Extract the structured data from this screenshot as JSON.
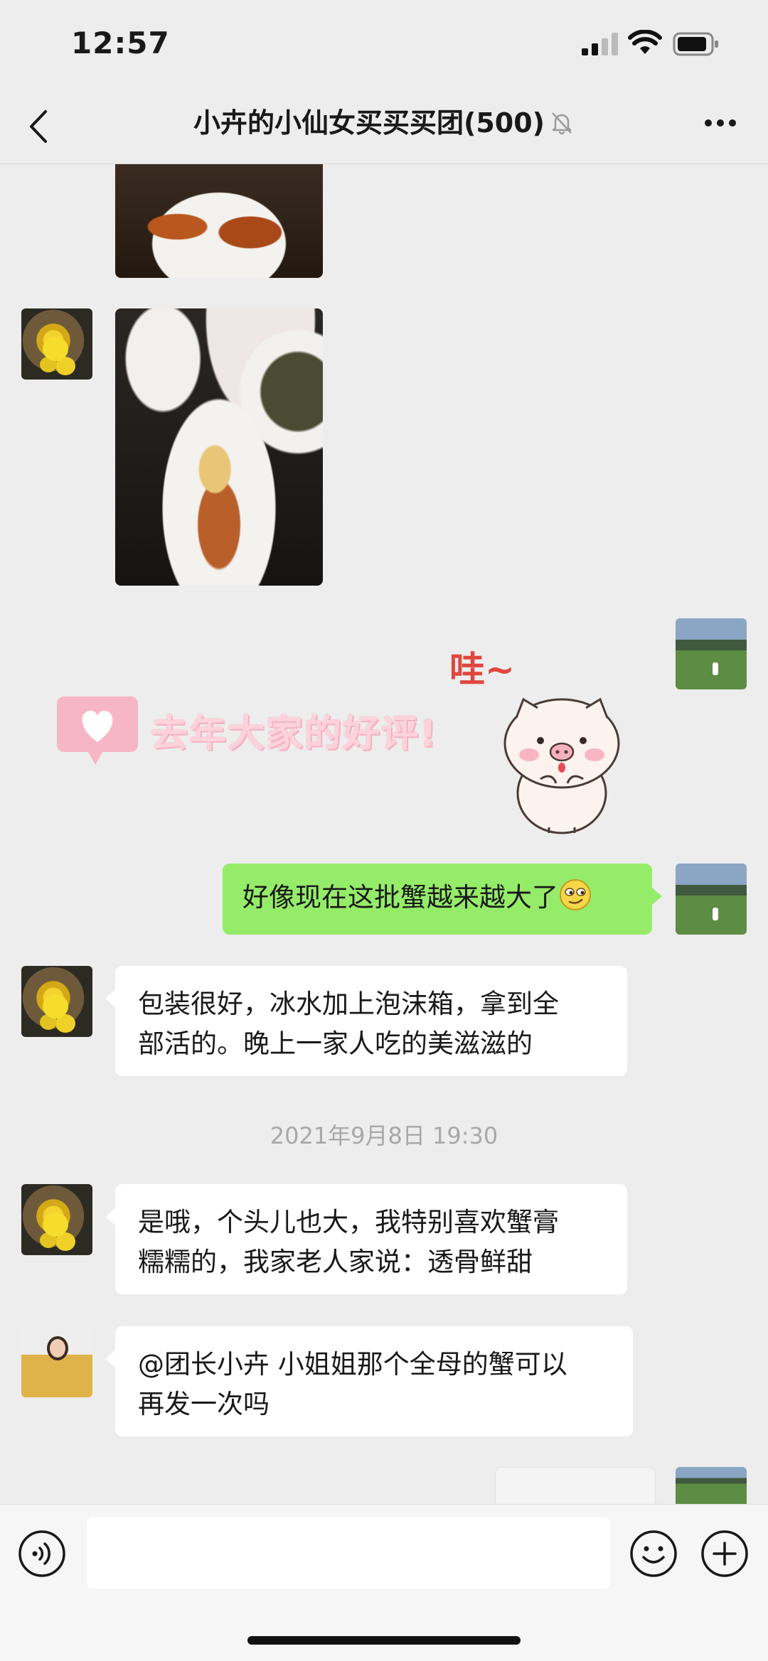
{
  "status_bar": {
    "time": "12:57"
  },
  "header": {
    "title": "小卉的小仙女买买买团(500)"
  },
  "messages": [
    {
      "type": "image",
      "side": "left",
      "description": "crab-photo"
    },
    {
      "type": "image",
      "side": "left",
      "description": "crab-dinner-photo"
    },
    {
      "type": "sticker",
      "side": "right",
      "caption": "哇~",
      "overlay_caption": "去年大家的好评!"
    },
    {
      "type": "text",
      "side": "right",
      "text": "好像现在这批蟹越来越大了"
    },
    {
      "type": "text",
      "side": "left",
      "text": "包装很好，冰水加上泡沫箱，拿到全\n部活的。晚上一家人吃的美滋滋的"
    },
    {
      "type": "time",
      "text": "2021年9月8日 19:30"
    },
    {
      "type": "text",
      "side": "left",
      "text": "是哦，个头儿也大，我特别喜欢蟹膏\n糯糯的，我家老人家说：透骨鲜甜"
    },
    {
      "type": "text",
      "side": "left",
      "text": "@团长小卉 小姐姐那个全母的蟹可以\n再发一次吗"
    }
  ],
  "input_bar": {
    "placeholder": ""
  },
  "colors": {
    "self_bubble": "#95ec69",
    "other_bubble": "#ffffff",
    "background": "#ededed"
  }
}
